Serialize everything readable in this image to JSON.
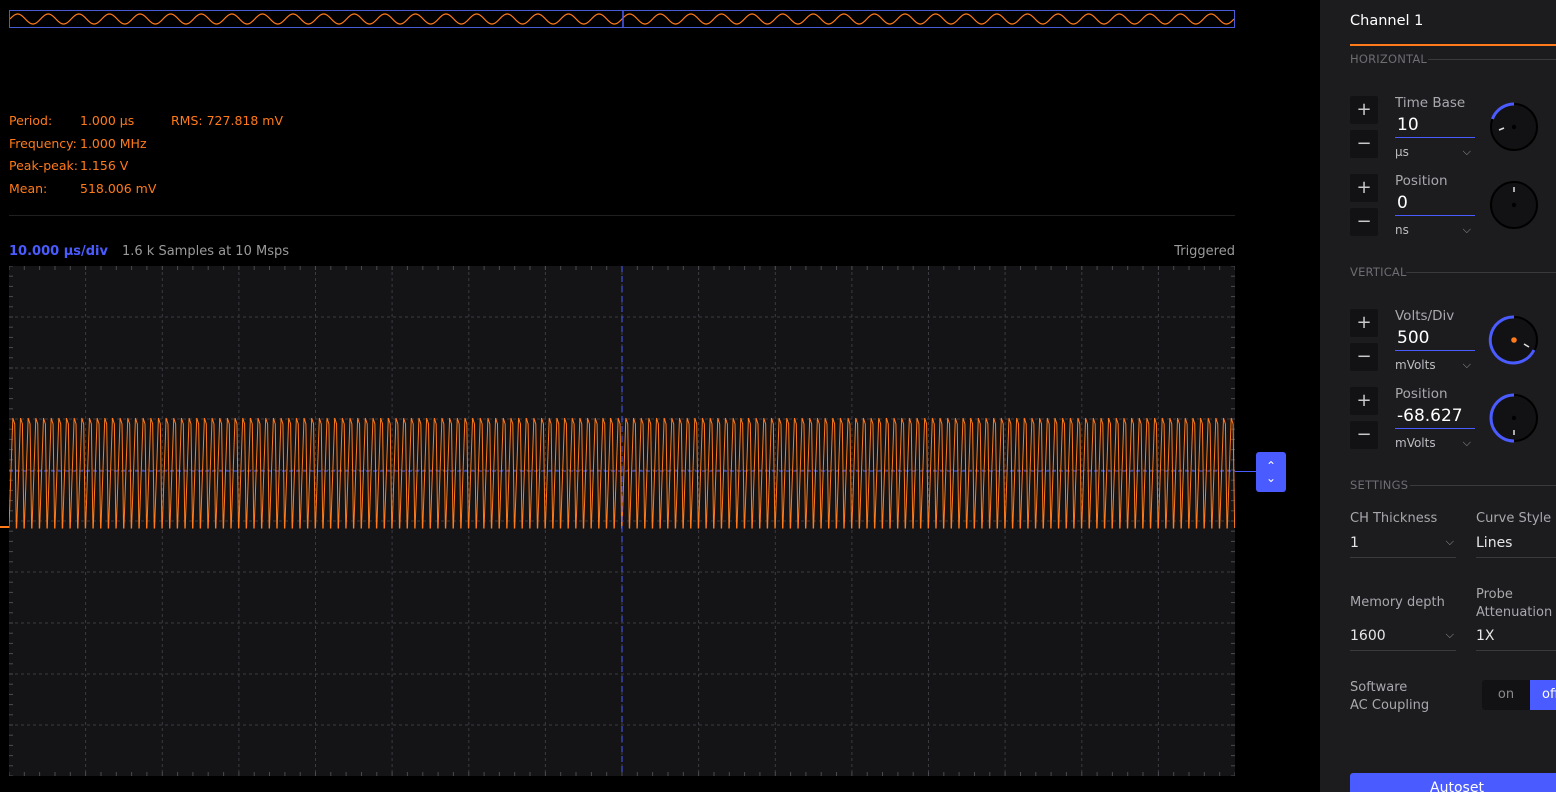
{
  "measurements": {
    "period": {
      "label": "Period:",
      "value": "1.000 µs"
    },
    "rms": {
      "label": "RMS:",
      "value": "727.818 mV"
    },
    "frequency": {
      "label": "Frequency:",
      "value": "1.000 MHz"
    },
    "peak_peak": {
      "label": "Peak-peak:",
      "value": "1.156 V"
    },
    "mean": {
      "label": "Mean:",
      "value": "518.006 mV"
    }
  },
  "plot_info": {
    "timebase_per_div": "10.000 µs/div",
    "samples": "1.6 k Samples at 10 Msps",
    "status": "Triggered"
  },
  "signal": {
    "frequency_mhz": 1.0,
    "peak_peak_v": 1.156,
    "mean_mv": 518.006,
    "cycles_visible": 160,
    "color": "#ff7a1a"
  },
  "colors": {
    "accent": "#4a5bff",
    "signal": "#ff7a1a",
    "panel_bg": "#1c1c1f",
    "plot_bg": "#141417"
  },
  "panel": {
    "title": "Channel 1",
    "horizontal": {
      "section_label": "HORIZONTAL",
      "time_base": {
        "label": "Time Base",
        "value": "10",
        "unit": "µs",
        "plus": "+",
        "minus": "−"
      },
      "position": {
        "label": "Position",
        "value": "0",
        "unit": "ns",
        "plus": "+",
        "minus": "−"
      }
    },
    "vertical": {
      "section_label": "VERTICAL",
      "volts_div": {
        "label": "Volts/Div",
        "value": "500",
        "unit": "mVolts",
        "plus": "+",
        "minus": "−"
      },
      "position": {
        "label": "Position",
        "value": "-68.627",
        "unit": "mVolts",
        "plus": "+",
        "minus": "−"
      }
    },
    "settings": {
      "section_label": "SETTINGS",
      "ch_thickness": {
        "label": "CH Thickness",
        "value": "1"
      },
      "curve_style": {
        "label": "Curve Style",
        "value": "Lines"
      },
      "memory_depth": {
        "label": "Memory depth",
        "value": "1600"
      },
      "probe_attenuation": {
        "label": "Probe\nAttenuation",
        "value": "1X"
      },
      "ac_coupling": {
        "label": "Software\nAC Coupling",
        "off_label": "on",
        "on_label": "off"
      }
    },
    "autoset_label": "Autoset"
  },
  "icons": {
    "chevron": "chevron-down-icon",
    "offset": "up-down-arrows-icon"
  }
}
